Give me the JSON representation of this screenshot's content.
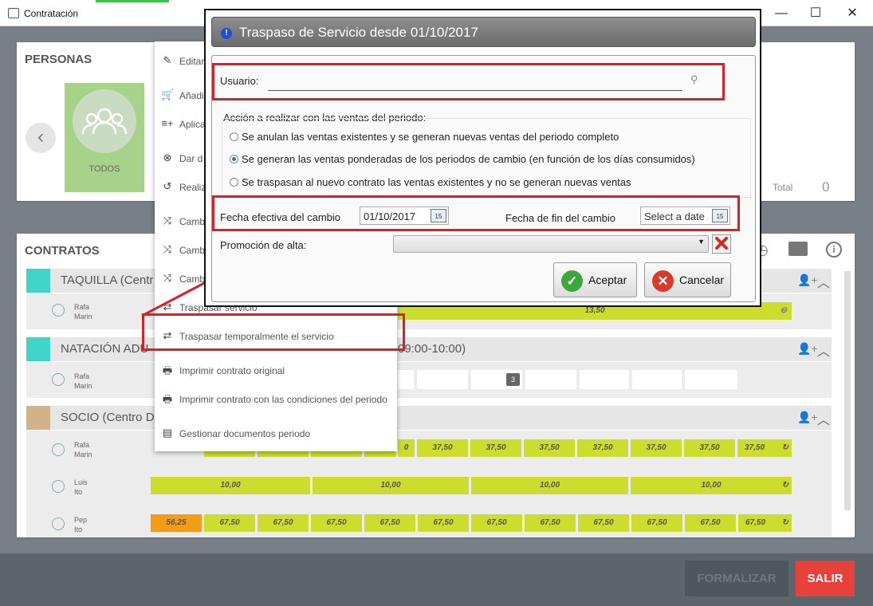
{
  "window": {
    "title": "Contratación",
    "minimize": "—",
    "maximize": "☐",
    "close": "✕"
  },
  "personas": {
    "title": "PERSONAS",
    "todos_label": "TODOS",
    "total_label": "Total",
    "total_value": "0"
  },
  "contratos": {
    "title": "CONTRATOS",
    "groups": [
      {
        "name": "TAQUILLA (Centr",
        "color": "#40d4c8",
        "people": [
          {
            "first": "Rafa",
            "last": "Marin",
            "bar": "13,50"
          }
        ]
      },
      {
        "name": "NATACIÓN ADU",
        "suffix": "09:00-10:00)",
        "color": "#40d4c8",
        "people": [
          {
            "first": "Rafa",
            "last": "Marin",
            "badge": "3"
          }
        ]
      },
      {
        "name": "SOCIO (Centro D",
        "color": "#d1b289",
        "people": [
          {
            "first": "Rafa",
            "last": "Marin",
            "cells": [
              "0",
              "37,50",
              "37,50",
              "37,50",
              "37,50",
              "37,50",
              "37,50",
              "37,50"
            ]
          },
          {
            "first": "Luis",
            "last": "Ito",
            "cells": [
              "10,00",
              "10,00",
              "10,00",
              "10,00"
            ]
          },
          {
            "first": "Pep",
            "last": "Ito",
            "cells": [
              "56,25",
              "67,50",
              "67,50",
              "67,50",
              "67,50",
              "67,50",
              "67,50",
              "67,50",
              "67,50",
              "67,50",
              "67,50",
              "67,50"
            ]
          }
        ]
      }
    ]
  },
  "menu": {
    "items": [
      {
        "icon": "✎",
        "label": "Editar"
      },
      {
        "icon": "🛒",
        "label": "Añadi"
      },
      {
        "icon": "≡+",
        "label": "Aplica"
      },
      {
        "icon": "⊗",
        "label": "Dar d"
      },
      {
        "icon": "↺",
        "label": "Realiz"
      },
      {
        "icon": "⤨",
        "label": "Camb"
      },
      {
        "icon": "⤨",
        "label": "Camb"
      },
      {
        "icon": "⤨",
        "label": "Camb"
      },
      {
        "icon": "⇄",
        "label": "Traspasar servicio"
      },
      {
        "icon": "⇄",
        "label": "Traspasar temporalmente el servicio"
      },
      {
        "icon": "🖶",
        "label": "Imprimir contrato original"
      },
      {
        "icon": "🖶",
        "label": "Imprimir contrato con las condiciones del periodo"
      },
      {
        "icon": "▤",
        "label": "Gestionar documentos periodo"
      }
    ]
  },
  "dialog": {
    "title": "Traspaso de Servicio desde 01/10/2017",
    "usuario_label": "Usuario:",
    "usuario_value": "",
    "accion_label": "Acción a realizar con las ventas del periodo:",
    "options": [
      {
        "label": "Se anulan las ventas existentes y se generan nuevas ventas del periodo completo",
        "selected": false
      },
      {
        "label": "Se generan las ventas ponderadas de los periodos de cambio (en función de los días consumidos)",
        "selected": true
      },
      {
        "label": "Se traspasan al nuevo contrato las ventas existentes y no se generan nuevas ventas",
        "selected": false
      }
    ],
    "fecha_efectiva_label": "Fecha efectiva del cambio",
    "fecha_efectiva_value": "01/10/2017",
    "fecha_fin_label": "Fecha de fin del cambio",
    "fecha_fin_placeholder": "Select a date",
    "calendar_day": "15",
    "promocion_label": "Promoción de alta:",
    "promocion_value": "",
    "accept_label": "Aceptar",
    "cancel_label": "Cancelar"
  },
  "footer": {
    "formalizar_label": "FORMALIZAR",
    "salir_label": "SALIR"
  },
  "colors": {
    "accent_green": "#cddd2e",
    "salir_red": "#e8413c",
    "highlight_red": "#dc1f26"
  }
}
